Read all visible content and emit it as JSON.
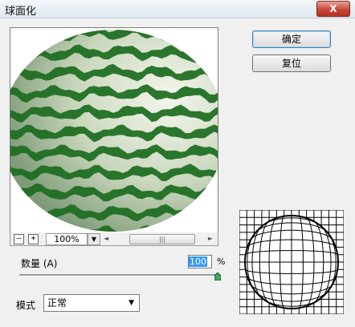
{
  "window": {
    "title": "球面化",
    "close_label": "X"
  },
  "buttons": {
    "ok_label": "确定",
    "reset_label": "复位"
  },
  "zoom": {
    "minus_label": "–",
    "plus_label": "+",
    "value": "100%",
    "drop_label": "▼"
  },
  "scroll": {
    "left_arrow": "◄",
    "right_arrow": "►",
    "thumb_grip": "|||"
  },
  "amount": {
    "label": "数量 (A)",
    "value": "100",
    "unit": "%",
    "level_percent": 100
  },
  "mode": {
    "label": "模式",
    "value": "正常",
    "arrow": "▼"
  },
  "colors": {
    "stripe": "#1b6b1e",
    "highlight": "#eef2e4",
    "accent": "#3399ff"
  }
}
